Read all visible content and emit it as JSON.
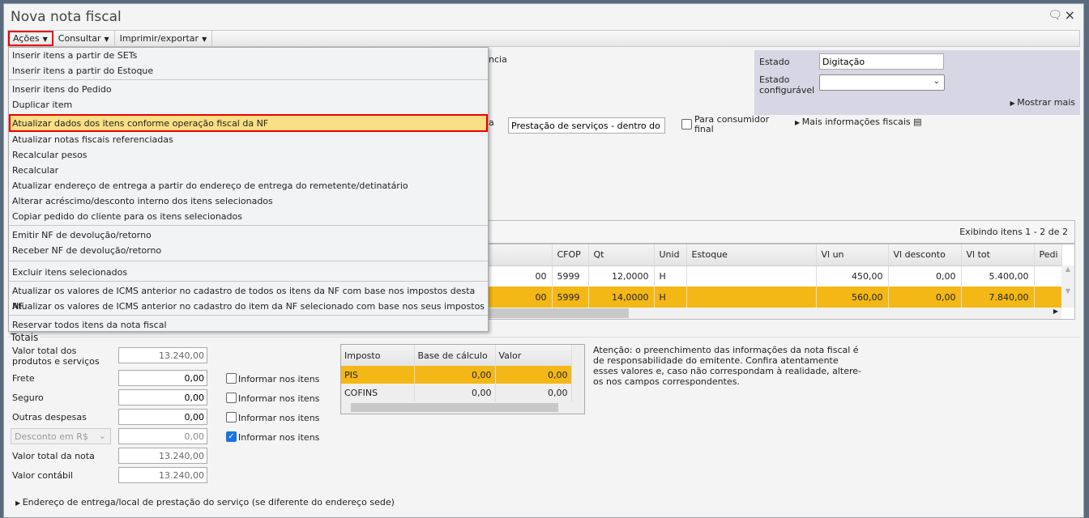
{
  "window": {
    "title": "Nova nota fiscal",
    "chat_icon": "chat-icon",
    "close_icon": "×"
  },
  "toolbar": {
    "acoes": "Ações",
    "consultar": "Consultar",
    "imprimir": "Imprimir/exportar"
  },
  "menu": {
    "items": [
      "Inserir itens a partir de SETs",
      "Inserir itens a partir do Estoque",
      "Inserir itens do Pedido",
      "Duplicar item",
      "Atualizar dados dos itens conforme operação fiscal da NF",
      "Atualizar notas fiscais referenciadas",
      "Recalcular pesos",
      "Recalcular",
      "Atualizar endereço de entrega a partir do endereço de entrega do remetente/detinatário",
      "Alterar acréscimo/desconto interno dos itens selecionados",
      "Copiar pedido do cliente para os itens selecionados",
      "Emitir NF de devolução/retorno",
      "Receber NF de devolução/retorno",
      "Excluir itens selecionados",
      "Atualizar os valores de ICMS anterior no cadastro de todos os itens da NF com base nos impostos desta NF",
      "Atualizar os valores de ICMS anterior no cadastro do item da NF selecionado com base nos seus impostos",
      "Reservar todos itens da nota fiscal"
    ]
  },
  "header": {
    "partial_label_1": "ncia",
    "partial_label_2": "a",
    "operacao": "Prestação de serviços - dentro do e",
    "consumidor_final": "Para consumidor final",
    "mais_info": "Mais informações fiscais",
    "estado_label": "Estado",
    "estado_value": "Digitação",
    "estado_conf_label": "Estado configurável",
    "estado_conf_value": "",
    "mostrar_mais": "Mostrar mais"
  },
  "grid": {
    "status": "Exibindo itens 1 - 2 de 2",
    "columns": [
      "",
      "CFOP",
      "Qt",
      "Unid",
      "Estoque",
      "Vl un",
      "Vl desconto",
      "Vl tot",
      "Pedi"
    ],
    "rows": [
      [
        "00",
        "5999",
        "12,0000",
        "H",
        "",
        "450,00",
        "0,00",
        "5.400,00",
        ""
      ],
      [
        "00",
        "5999",
        "14,0000",
        "H",
        "",
        "560,00",
        "0,00",
        "7.840,00",
        ""
      ]
    ]
  },
  "totais": {
    "title": "Totais",
    "valor_produtos_label": "Valor total dos produtos e serviços",
    "valor_produtos": "13.240,00",
    "frete_label": "Frete",
    "frete": "0,00",
    "seguro_label": "Seguro",
    "seguro": "0,00",
    "outras_label": "Outras despesas",
    "outras": "0,00",
    "desconto_select": "Desconto em R$",
    "desconto": "0,00",
    "valor_nota_label": "Valor total da nota",
    "valor_nota": "13.240,00",
    "valor_contabil_label": "Valor contábil",
    "valor_contabil": "13.240,00",
    "informar": "Informar nos itens",
    "checks": [
      false,
      false,
      false,
      true
    ]
  },
  "impostos": {
    "columns": [
      "Imposto",
      "Base de cálculo",
      "Valor"
    ],
    "rows": [
      [
        "PIS",
        "0,00",
        "0,00"
      ],
      [
        "COFINS",
        "0,00",
        "0,00"
      ]
    ]
  },
  "aviso": "Atenção: o preenchimento das informações da nota fiscal é de responsabilidade do emitente. Confira atentamente esses valores e, caso não correspondam à realidade, altere-os nos campos correspondentes.",
  "endereco_entrega": "Endereço de entrega/local de prestação do serviço (se diferente do endereço sede)"
}
